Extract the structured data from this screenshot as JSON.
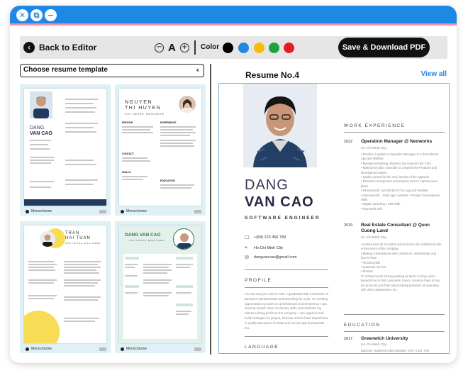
{
  "toolbar": {
    "back_label": "Back to Editor",
    "zoom_out": "−",
    "zoom_glyph": "A",
    "zoom_in": "+",
    "color_label": "Color",
    "colors": [
      "#000000",
      "#1e88e5",
      "#f9b90a",
      "#1aa33f",
      "#e51c23"
    ],
    "save_label": "Save & Download PDF"
  },
  "titlebar": {
    "close": "✕",
    "copy": "⧉",
    "minimize": "−"
  },
  "left": {
    "choose_label": "Choose resume template",
    "chevron": "‹",
    "templates": [
      {
        "footer": "Monochrome"
      },
      {
        "footer": "Monochrome",
        "name_l1": "NGUYEN",
        "name_l2": "THI HUYEN",
        "role": "SOFTWARE ENGINEER",
        "sections": [
          "PROFILE",
          "EXPERIENCE",
          "CONTACT",
          "SKILLS",
          "EDUCATION"
        ]
      },
      {
        "footer": "Monochrome",
        "name_l1": "TRAN",
        "name_l2": "HAI TUAN",
        "role": "SOFTWARE ENGINEER"
      },
      {
        "footer": "Monochrome",
        "name": "DANG VAN CAO",
        "role": "SOFTWARE ENGINEER"
      }
    ],
    "template1": {
      "name_l1": "DANG",
      "name_l2": "VAN CAO"
    }
  },
  "right": {
    "title": "Resume No.4",
    "view_all": "View all",
    "resume": {
      "first_name": "DANG",
      "last_name": "VAN CAO",
      "role": "SOFTWARE ENGINEER",
      "contacts": [
        {
          "icon": "phone-icon",
          "glyph": "☐",
          "text": "+(84) 123 456 789"
        },
        {
          "icon": "location-icon",
          "glyph": "⌖",
          "text": "Ho Chi Minh City"
        },
        {
          "icon": "email-icon",
          "glyph": "✉",
          "text": "dangvancao@gmail.com"
        }
      ],
      "profile_title": "PROFILE",
      "profile_text": "I'm Cao and you call me ABC. I graduated with a Bachelor of Business Administration and searching for a job. I'm seeking opportunities to work in a professional environment so I can develop myself, learn necessary skills, and dedicate my talents to bring profits to the company. I can organize and build strategies for project, harness of their have department in quality assurance for Data and service app and website too.",
      "language_title": "LANGUAGE",
      "work_title": "WORK EXPERIENCE",
      "jobs": [
        {
          "year": "2022",
          "title": "Operation Manager @ Neoworks",
          "location": "Ho Chi Minh City",
          "bullets": [
            "• Position: Logistics & Operation Manager of a Recruitment App and Website",
            "• Manage everything related to the request from CEO",
            "• Making the plan, schedule to complete the Products and Development plans",
            "• Quality control for the new function of the App/web",
            "• Research to improved and propose service improvement plans",
            "• Develop B2C and bb2B2 for the App and Website Achievements: - Build app / website + Product Development skills",
            "• Digital marketing x 360 skills",
            "• Teamwork skill"
          ]
        },
        {
          "year": "2019",
          "title": "Real Estate Consultant @ Quoc Cuong Land",
          "location": "Ho Chi Minh City",
          "bullets": [
            "I worked here for 3 months and learned a lot of skills from the environment of the company",
            "• Making conversations with customers, relationships and face-to-face",
            "• Planning skill",
            "• Customer service",
            "• Presale",
            "IT Achievements: During working as Quốc Cường Land, I learned how to find customers, how to convince them to buy the products and think about solving problems as operating with other departments, etc."
          ]
        }
      ],
      "education_title": "EDUCATION",
      "edu": {
        "year": "2017",
        "school": "Greenwich University",
        "location": "Ho Chi Minh City",
        "desc": "Bachelor: Business Administration, GPA: 3.3/4. This"
      }
    }
  }
}
